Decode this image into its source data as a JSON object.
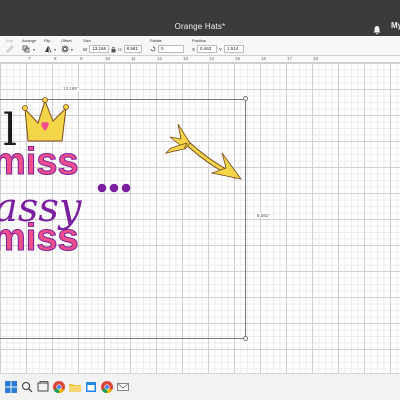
{
  "window": {
    "title": "Orange Hats*",
    "user_label": "My"
  },
  "toolbar": {
    "edit_label": "Edit",
    "arrange_label": "Arrange",
    "flip_label": "Flip",
    "offset_label": "Offset",
    "size_label": "Size",
    "size_w_prefix": "W",
    "size_w_value": "13.165",
    "size_h_prefix": "H",
    "size_h_value": "8.581",
    "rotate_label": "Rotate",
    "rotate_value": "0",
    "position_label": "Position",
    "pos_x_prefix": "X",
    "pos_x_value": "0.463",
    "pos_y_prefix": "Y",
    "pos_y_value": "1.514"
  },
  "ruler": {
    "ticks": [
      "7",
      "8",
      "9",
      "10",
      "11",
      "12",
      "13",
      "14",
      "15",
      "16",
      "17",
      "18"
    ]
  },
  "canvas": {
    "width_dim": "13.165\"",
    "height_dim": "8.581\"",
    "design_text_line1": "l",
    "design_text_line2": "miss",
    "design_text_line3": "assy",
    "design_text_line4": "miss"
  },
  "colors": {
    "pink": "#ef4e8c",
    "purple": "#7a1fa0",
    "gold": "#f3d54a",
    "outline": "#7a4a1a"
  },
  "taskbar": {
    "icons": [
      "windows-icon",
      "search-icon",
      "task-view-icon",
      "file-explorer-icon",
      "chrome-icon",
      "edge-icon",
      "mail-icon",
      "calendar-icon",
      "chrome-icon"
    ]
  }
}
